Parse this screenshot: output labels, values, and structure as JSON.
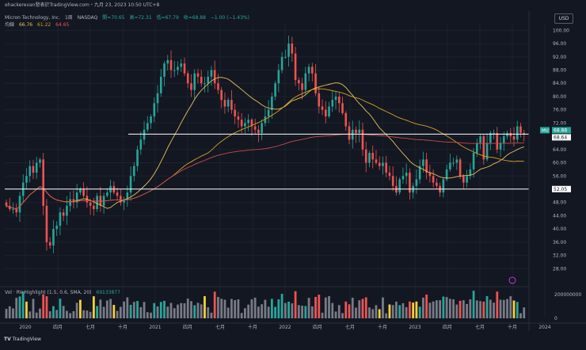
{
  "watermark": "ehackerevan發表於TradingView.com・九月 23, 2023 10:50 UTC+8",
  "header": {
    "symbol": "Micron Technology, Inc.",
    "interval": "1周",
    "exchange": "NASDAQ",
    "open": "開=70.65",
    "high": "高=72.31",
    "low": "低=67.79",
    "close": "收=68.88",
    "change": "−1.00 (−1.43%)"
  },
  "ma_legend": {
    "name": "均線",
    "v1": "66.76",
    "v2": "61.22",
    "v3": "64.65"
  },
  "volume_legend": {
    "name": "Vol · RV Highlight (1.5, 0.6, SMA, 20)",
    "value": "69133877"
  },
  "currency_button": "USD",
  "brand": "TradingView",
  "colors": {
    "up": "#26a69a",
    "down": "#ef5350",
    "ma20": "#e8c15a",
    "ma50": "#d6a11e",
    "ma200": "#c84a4a",
    "hline": "#ffffff",
    "bg": "#131722"
  },
  "chart_data": {
    "type": "candlestick",
    "ylim": [
      24,
      102
    ],
    "y_ticks": [
      "100.00",
      "96.00",
      "92.00",
      "88.00",
      "84.00",
      "80.00",
      "76.00",
      "72.00",
      "68.00",
      "64.00",
      "60.00",
      "56.00",
      "52.00",
      "48.00",
      "44.00",
      "40.00",
      "36.00",
      "32.00",
      "28.00"
    ],
    "x_ticks": [
      "2020",
      "四月",
      "七月",
      "十月",
      "2021",
      "四月",
      "七月",
      "十月",
      "2022",
      "四月",
      "七月",
      "十月",
      "2023",
      "四月",
      "七月",
      "十月",
      "2024"
    ],
    "price_labels": [
      {
        "symbol": "MU",
        "value": "68.88"
      },
      {
        "symbol": "",
        "value": "68.64"
      },
      {
        "symbol": "",
        "value": "52.05"
      }
    ],
    "horizontal_lines": [
      68.64,
      52.05
    ],
    "volume_ticks": [
      "200000000",
      "0"
    ],
    "closes": [
      47,
      46,
      46,
      45,
      50,
      54,
      56,
      59,
      57,
      60,
      61,
      47,
      36,
      35,
      40,
      41,
      45,
      44,
      47,
      49,
      48,
      51,
      52,
      50,
      48,
      47,
      46,
      50,
      47,
      50,
      51,
      53,
      51,
      50,
      48,
      49,
      51,
      56,
      59,
      64,
      67,
      70,
      72,
      74,
      78,
      81,
      86,
      90,
      91,
      88,
      88,
      89,
      90,
      87,
      84,
      82,
      87,
      86,
      84,
      84,
      86,
      88,
      84,
      82,
      79,
      77,
      79,
      76,
      74,
      73,
      71,
      72,
      73,
      71,
      70,
      69,
      72,
      74,
      76,
      80,
      84,
      88,
      92,
      92,
      96,
      93,
      85,
      84,
      82,
      87,
      89,
      87,
      81,
      77,
      76,
      74,
      77,
      79,
      80,
      78,
      75,
      71,
      67,
      70,
      69,
      70,
      64,
      60,
      63,
      61,
      60,
      59,
      60,
      57,
      56,
      53,
      51,
      55,
      56,
      57,
      51,
      53,
      55,
      59,
      61,
      57,
      56,
      54,
      53,
      51,
      55,
      58,
      60,
      60,
      61,
      56,
      54,
      56,
      58,
      63,
      66,
      68,
      61,
      66,
      69,
      69,
      64,
      66,
      68,
      69,
      68,
      67,
      71,
      69,
      68.88
    ]
  }
}
